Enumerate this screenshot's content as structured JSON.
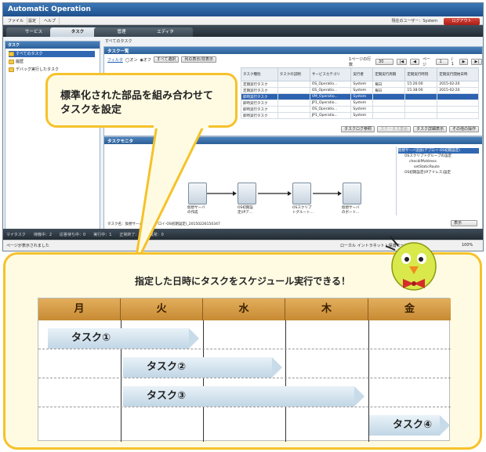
{
  "window": {
    "title": "Automatic Operation",
    "menu": [
      "ファイル",
      "設定",
      "ヘルプ"
    ],
    "user_line": "現在のユーザー：System",
    "logout": "ログアウト",
    "tabs": [
      {
        "label": "サービス",
        "active": false
      },
      {
        "label": "タスク",
        "active": true
      },
      {
        "label": "管理",
        "active": false
      },
      {
        "label": "エディタ",
        "active": false
      }
    ]
  },
  "sidebar": {
    "title": "タスク",
    "items": [
      {
        "label": "すべてのタスク",
        "selected": true
      },
      {
        "label": "履歴",
        "selected": false
      },
      {
        "label": "デバッグ実行したタスク",
        "selected": false
      }
    ]
  },
  "breadcrumb": "すべてのタスク",
  "task_list": {
    "title": "タスク一覧",
    "filter_label": "フィルタ",
    "filter_on": "オン",
    "filter_off": "オフ",
    "select_all": "すべて選択",
    "columns_toggle": "列の表示/非表示",
    "per_page_label": "1ページの行数",
    "per_page_value": "30",
    "page_label": "ページ",
    "page_value": "1",
    "page_total": "/ 1",
    "columns": [
      "タスク種別",
      "タスクの説明",
      "サービスカテゴリ",
      "実行者",
      "定期実行周期",
      "定期実行時刻",
      "定期実行開始日時"
    ],
    "rows": [
      {
        "type": "定期実行タスク",
        "desc": "",
        "category": "OS_Operatio...",
        "user": "System",
        "cycle": "毎日",
        "time": "15:26:00",
        "start": "2015-02-20",
        "selected": false
      },
      {
        "type": "定期実行タスク",
        "desc": "",
        "category": "OS_Operatio...",
        "user": "System",
        "cycle": "毎日",
        "time": "15:38:00",
        "start": "2015-02-20",
        "selected": false
      },
      {
        "type": "即時実行タスク",
        "desc": "",
        "category": "VM_Operatio...",
        "user": "System",
        "cycle": "",
        "time": "",
        "start": "",
        "selected": true
      },
      {
        "type": "即時実行タスク",
        "desc": "",
        "category": "JP1_Operatio...",
        "user": "System",
        "cycle": "",
        "time": "",
        "start": "",
        "selected": false
      },
      {
        "type": "即時実行タスク",
        "desc": "",
        "category": "OS_Operatio...",
        "user": "System",
        "cycle": "",
        "time": "",
        "start": "",
        "selected": false
      },
      {
        "type": "即時実行タスク",
        "desc": "",
        "category": "JP1_Operatio...",
        "user": "System",
        "cycle": "",
        "time": "",
        "start": "",
        "selected": false
      }
    ],
    "footer_buttons": [
      "タスクログ参照",
      "ステータス変更",
      "タスク詳細表示",
      "その他の操作"
    ]
  },
  "monitor": {
    "title": "タスクモニタ",
    "nodes": [
      {
        "label": "仮想サーバ\nの作成"
      },
      {
        "label": "OS初期設\n定(IPア..."
      },
      {
        "label": "OSスクリプ\nトグルート..."
      },
      {
        "label": "仮想サーバ\nのボート..."
      }
    ],
    "tree": [
      "仮想サーバ追加(デプロイ-OS初期設定)",
      "OSスクリプトグループの設定",
      "checkIPAddress",
      "setStaticRoute",
      "OS初期設定(IPアドレス)設定"
    ],
    "footer_text": "タスク名：仮想サーバ追加(デプロイ-OS初期設定)_20150226150347",
    "display_button": "表示"
  },
  "bottom_bar": {
    "label": "マイタスク",
    "items": [
      "待機中：2",
      "応答待ち中：0",
      "実行中：1",
      "正常終了：3",
      "異常：0"
    ]
  },
  "statusbar": {
    "left": "ページが表示されました",
    "zone": "ローカル イントラネット | 保護モード: 無効",
    "zoom": "100%"
  },
  "callout_text": "標準化された部品を組み合わせて\nタスクを設定",
  "schedule": {
    "title": "指定した日時にタスクをスケジュール実行できる！",
    "days": [
      "月",
      "火",
      "水",
      "木",
      "金"
    ],
    "tasks": [
      "タスク①",
      "タスク②",
      "タスク③",
      "タスク④"
    ]
  }
}
